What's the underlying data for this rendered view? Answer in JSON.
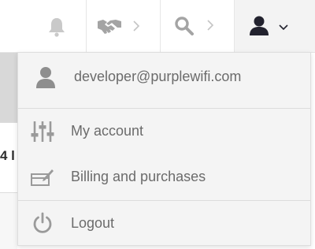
{
  "navbar": {
    "notifications_icon": "bell-icon",
    "deals_icon": "handshake-icon",
    "search_icon": "search-icon",
    "user_icon": "user-icon"
  },
  "background": {
    "fragment_text": "4 l"
  },
  "dropdown": {
    "email": "developer@purplewifi.com",
    "items": [
      {
        "label": "My account",
        "icon": "sliders-icon"
      },
      {
        "label": "Billing and purchases",
        "icon": "billing-icon"
      },
      {
        "label": "Logout",
        "icon": "power-icon"
      }
    ]
  },
  "colors": {
    "icon_light": "#c4c4c4",
    "icon_mid": "#9a9a9a",
    "icon_dark": "#2b2b36",
    "menu_text": "#6b6b6b",
    "menu_bg": "#f4f4f4"
  }
}
